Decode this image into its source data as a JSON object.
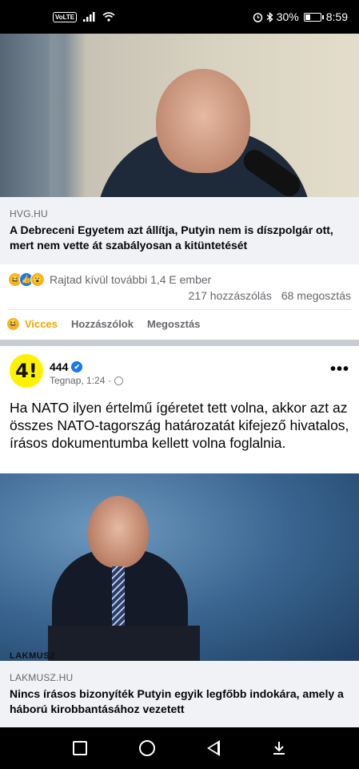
{
  "status_bar": {
    "volte": "VoLTE",
    "battery": "30%",
    "time": "8:59",
    "icons": [
      "signal-icon",
      "wifi-icon",
      "alarm-icon",
      "bluetooth-icon",
      "battery-icon"
    ]
  },
  "post1": {
    "link": {
      "domain": "HVG.HU",
      "title": "A Debreceni Egyetem azt állítja, Putyin nem is díszpolgár ott, mert nem vette át szabályosan a kitüntetését"
    },
    "reactions_text": "Rajtad kívül további 1,4 E ember",
    "comments": "217 hozzászólás",
    "shares": "68 megosztás",
    "actions": {
      "react": "Vicces",
      "comment": "Hozzászólok",
      "share": "Megosztás"
    }
  },
  "post2": {
    "page_name": "444",
    "time": "Tegnap, 1:24",
    "separator": "·",
    "avatar_text": "4!",
    "more": "•••",
    "text": "Ha NATO ilyen értelmű ígéretet tett volna, akkor azt az összes NATO-tagország határozatát kifejező hivatalos, írásos dokumentumba kellett volna foglalnia.",
    "image_watermark": "LAKMUSZ",
    "link": {
      "domain": "LAKMUSZ.HU",
      "title": "Nincs írásos bizonyíték Putyin egyik legfőbb indokára, amely a háború kirobbantásához vezetett"
    }
  },
  "nav_bar": {
    "icons": [
      "recents-square-icon",
      "home-circle-icon",
      "back-triangle-icon",
      "notification-pull-icon"
    ]
  },
  "colors": {
    "accent": "#1877f2",
    "vicces": "#f0a300",
    "secondary_text": "#65676b",
    "avatar_bg": "#fff200"
  }
}
